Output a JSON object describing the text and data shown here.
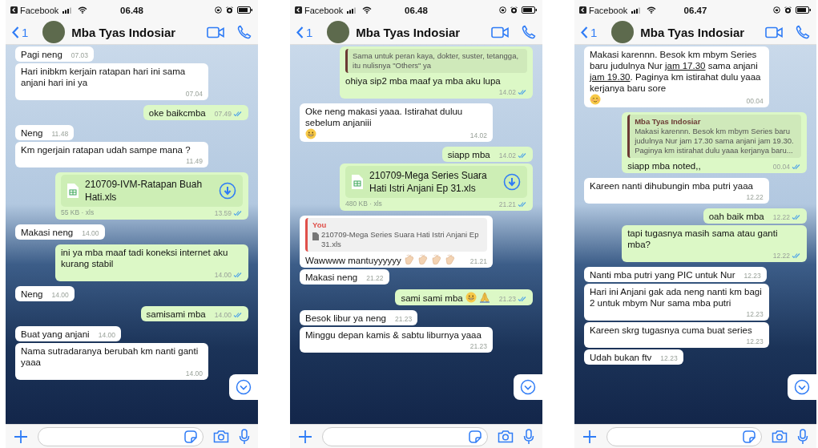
{
  "phones": [
    {
      "status_bar": {
        "app": "Facebook",
        "time": "06.48"
      },
      "header": {
        "back_count": "1",
        "name": "Mba Tyas Indosiar"
      },
      "scroll_down": true,
      "messages": [
        {
          "kind": "text",
          "outgoing": false,
          "text": "Pagi neng",
          "time": "07.03"
        },
        {
          "kind": "text",
          "outgoing": false,
          "text": "Hari inibkm kerjain ratapan hari ini sama anjani hari ini ya",
          "time": "07.04"
        },
        {
          "kind": "text",
          "outgoing": true,
          "text": "oke baikcmba",
          "time": "07.49",
          "read": true
        },
        {
          "kind": "text",
          "outgoing": false,
          "text": "Neng",
          "time": "11.48"
        },
        {
          "kind": "text",
          "outgoing": false,
          "text": "Km ngerjain ratapan udah sampe mana ?",
          "time": "11.49"
        },
        {
          "kind": "file",
          "outgoing": true,
          "file_name": "210709-IVM-Ratapan Buah Hati.xls",
          "size": "55 KB · xls",
          "time": "13.59",
          "read": true
        },
        {
          "kind": "text",
          "outgoing": false,
          "text": "Makasi neng",
          "time": "14.00"
        },
        {
          "kind": "text",
          "outgoing": true,
          "text": "ini ya mba maaf tadi koneksi internet aku kurang stabil",
          "time": "14.00",
          "read": true
        },
        {
          "kind": "text",
          "outgoing": false,
          "text": "Neng",
          "time": "14.00"
        },
        {
          "kind": "text",
          "outgoing": true,
          "text": "samisami mba",
          "time": "14.00",
          "read": true
        },
        {
          "kind": "text",
          "outgoing": false,
          "text": "Buat yang anjani",
          "time": "14.00"
        },
        {
          "kind": "text",
          "outgoing": false,
          "text": "Nama sutradaranya berubah km nanti ganti yaaa",
          "time": "14.00"
        }
      ]
    },
    {
      "status_bar": {
        "app": "Facebook",
        "time": "06.48"
      },
      "header": {
        "back_count": "1",
        "name": "Mba Tyas Indosiar"
      },
      "scroll_down": true,
      "messages": [
        {
          "kind": "reply",
          "outgoing": true,
          "quote": {
            "text": "Sama untuk peran kaya, dokter, suster, tetangga, itu nulisnya \"Others\" ya",
            "color": "#6b3a34"
          },
          "text": "ohiya sip2 mba maaf ya mba aku lupa",
          "time": "14.02",
          "read": true
        },
        {
          "kind": "text",
          "outgoing": false,
          "text": "Oke neng makasi yaaa. Istirahat duluu sebelum anjaniii",
          "emojis": [
            {
              "kind": "grin"
            }
          ],
          "time": "14.02"
        },
        {
          "kind": "text",
          "outgoing": true,
          "text": "siapp mba",
          "time": "14.02",
          "read": true
        },
        {
          "kind": "file",
          "outgoing": true,
          "file_name": "210709-Mega Series Suara Hati Istri Anjani Ep 31.xls",
          "size": "480 KB · xls",
          "time": "21.21",
          "read": true
        },
        {
          "kind": "reply",
          "outgoing": false,
          "quote": {
            "author": "You",
            "text": "210709-Mega Series Suara Hati Istri Anjani Ep 31.xls",
            "file": true,
            "color": "#e0504a"
          },
          "text": "Wawwww mantuyyyyyy",
          "emojis": [
            {
              "kind": "clap"
            },
            {
              "kind": "clap"
            },
            {
              "kind": "clap"
            },
            {
              "kind": "clap"
            }
          ],
          "time": "21.21"
        },
        {
          "kind": "text",
          "outgoing": false,
          "text": "Makasi neng",
          "time": "21.22"
        },
        {
          "kind": "text",
          "outgoing": true,
          "text": "sami sami mba",
          "emojis": [
            {
              "kind": "grin"
            },
            {
              "kind": "pray"
            }
          ],
          "time": "21.23",
          "read": true
        },
        {
          "kind": "text",
          "outgoing": false,
          "text": "Besok libur ya neng",
          "time": "21.23"
        },
        {
          "kind": "text",
          "outgoing": false,
          "text": "Minggu depan kamis & sabtu liburnya yaaa",
          "time": "21.23"
        }
      ]
    },
    {
      "status_bar": {
        "app": "Facebook",
        "time": "06.47"
      },
      "header": {
        "back_count": "1",
        "name": "Mba Tyas Indosiar"
      },
      "scroll_down": true,
      "messages": [
        {
          "kind": "text",
          "outgoing": false,
          "segments": [
            {
              "kind": "plain",
              "text": "Makasi karennn. Besok km mbym Series baru judulnya Nur "
            },
            {
              "kind": "link",
              "text": "jam 17.30"
            },
            {
              "kind": "plain",
              "text": " sama anjani "
            },
            {
              "kind": "link",
              "text": "jam 19.30"
            },
            {
              "kind": "plain",
              "text": ". Paginya km istirahat dulu yaaa kerjanya baru sore"
            }
          ],
          "emojis": [
            {
              "kind": "blush"
            }
          ],
          "time": "00.04"
        },
        {
          "kind": "reply",
          "outgoing": true,
          "quote": {
            "author": "Mba Tyas Indosiar",
            "text": "Makasi karennn. Besok km mbym Series baru judulnya Nur jam 17.30 sama anjani jam 19.30. Paginya km istirahat dulu yaaa kerjanya baru...",
            "color": "#6b3a34"
          },
          "text": "siapp mba noted,,",
          "time": "00.04",
          "read": true
        },
        {
          "kind": "text",
          "outgoing": false,
          "text": "Kareen nanti dihubungin mba putri yaaa",
          "time": "12.22"
        },
        {
          "kind": "text",
          "outgoing": true,
          "text": "oah baik mba",
          "time": "12.22",
          "read": true
        },
        {
          "kind": "text",
          "outgoing": true,
          "text": "tapi tugasnya masih sama atau ganti mba?",
          "time": "12.22",
          "read": true
        },
        {
          "kind": "text",
          "outgoing": false,
          "text": "Nanti mba putri yang PIC untuk Nur",
          "time": "12.23"
        },
        {
          "kind": "text",
          "outgoing": false,
          "text": "Hari ini Anjani gak ada neng nanti km bagi 2 untuk mbym Nur sama mba putri",
          "time": "12.23"
        },
        {
          "kind": "text",
          "outgoing": false,
          "text": "Kareen skrg tugasnya cuma buat series",
          "time": "12.23"
        },
        {
          "kind": "text",
          "outgoing": false,
          "text": "Udah bukan ftv",
          "time": "12.23"
        }
      ]
    }
  ]
}
